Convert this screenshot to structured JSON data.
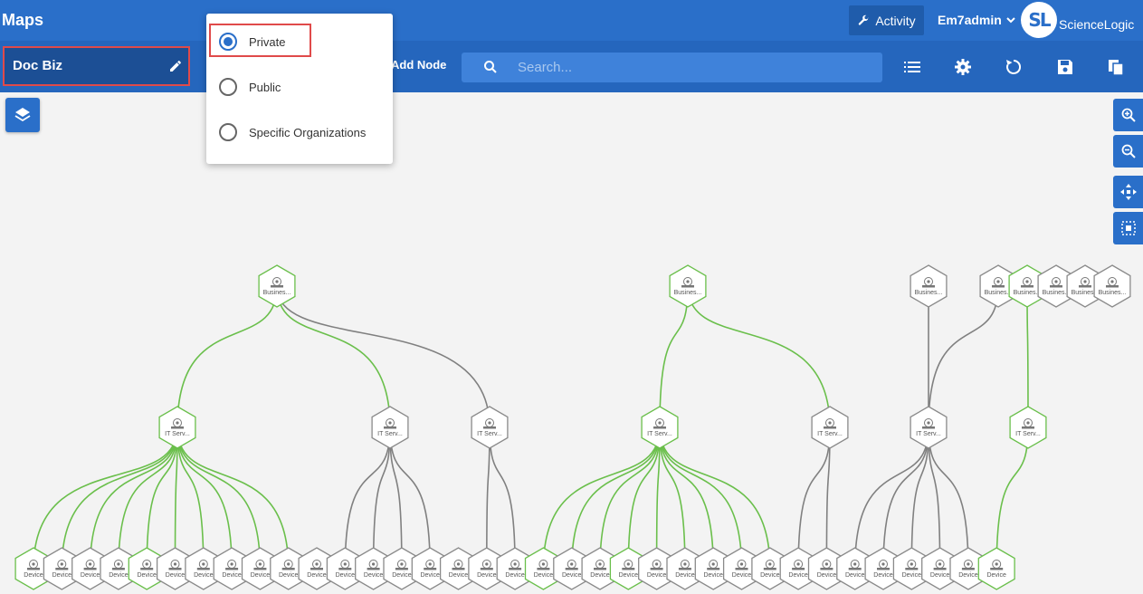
{
  "header": {
    "title": "Maps",
    "activity_label": "Activity",
    "user_label": "Em7admin",
    "logo_mark": "SL",
    "logo_text": "ScienceLogic"
  },
  "toolbar": {
    "map_name": "Doc Biz",
    "add_node_label": "Add Node",
    "search_placeholder": "Search...",
    "icons": [
      "list-icon",
      "gear-icon",
      "refresh-icon",
      "save-icon",
      "copy-icon"
    ]
  },
  "visibility_menu": {
    "options": [
      {
        "label": "Private",
        "selected": true
      },
      {
        "label": "Public",
        "selected": false
      },
      {
        "label": "Specific Organizations",
        "selected": false
      }
    ]
  },
  "map_controls": [
    "layers-icon",
    "zoom-in-icon",
    "zoom-out-icon",
    "pan-icon",
    "fit-icon"
  ],
  "colors": {
    "header_blue": "#2a6fc9",
    "toolbar_blue": "#2566bd",
    "link_green": "#6abf4b",
    "link_gray": "#808080",
    "highlight_red": "#e04a4a"
  },
  "graph": {
    "business_labels": [
      "Busines...",
      "Busines...",
      "Busines...",
      "Busines...",
      "Busines...",
      "Busines...",
      "Busines...",
      "Busines..."
    ],
    "it_service_label": "IT Serv...",
    "device_label": "Device"
  }
}
